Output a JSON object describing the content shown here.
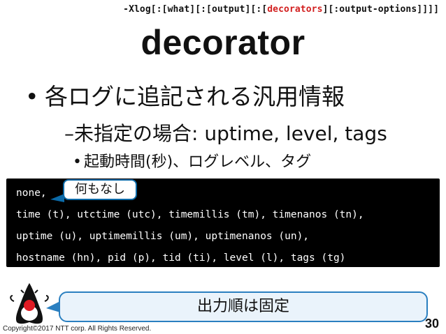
{
  "slide": {
    "command": {
      "prefix": "-Xlog[:[what][:[output][:[",
      "highlight": "decorators",
      "suffix": "][:output-options]]]]"
    },
    "title": "decorator",
    "bullet1": "各ログに追記される汎用情報",
    "bullet2": "–未指定の場合: uptime, level, tags",
    "bullet3": "起動時間(秒)、ログレベル、タグ",
    "code_lines": [
      "none,",
      "time (t), utctime (utc), timemillis (tm), timenanos (tn),",
      "uptime (u), uptimemillis (um), uptimenanos (un),",
      "hostname (hn), pid (p), tid (ti), level (l), tags (tg)"
    ],
    "callout_none": "何もなし",
    "callout_order": "出力順は固定",
    "copyright": "Copyright©2017  NTT corp. All Rights Reserved.",
    "page_number": "30"
  },
  "colors": {
    "highlight": "#d21f1f",
    "code_bg": "#000000",
    "callout_border": "#2a7fc0",
    "callout_fill": "#eaf3fb"
  },
  "icons": {
    "mascot": "duke-mascot-icon"
  }
}
